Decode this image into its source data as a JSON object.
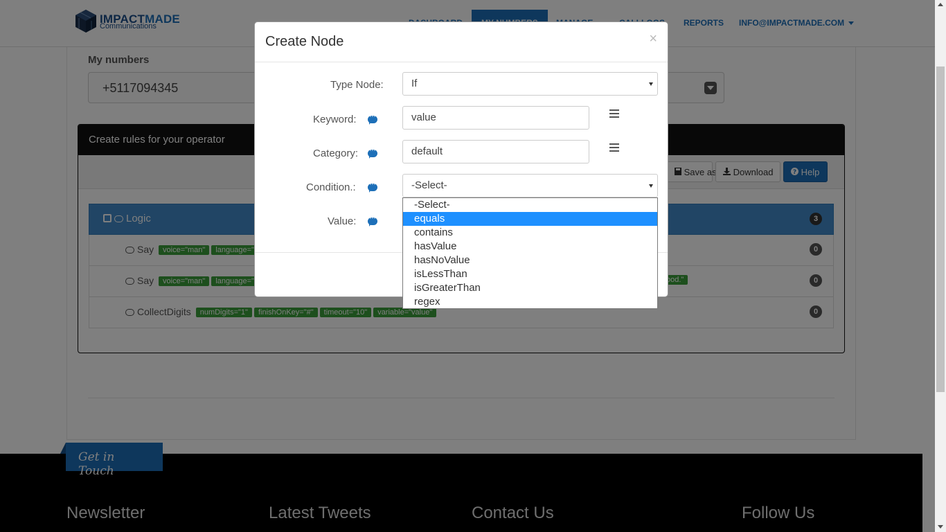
{
  "brand": {
    "name_part1": "IMPACT",
    "name_part2": "MADE",
    "tagline": "Communications"
  },
  "nav": {
    "items": [
      {
        "label": "DASHBOARD"
      },
      {
        "label": "MY NUMBERS"
      },
      {
        "label": "MANAGE"
      },
      {
        "label": "CALLLOGS"
      },
      {
        "label": "REPORTS"
      },
      {
        "label": "INFO@IMPACTMADE.COM"
      }
    ]
  },
  "numbers": {
    "label": "My numbers",
    "selected": "+5117094345"
  },
  "rules": {
    "title": "Create rules for your operator",
    "toolbar": {
      "save_as": "Save as",
      "download": "Download",
      "help": "Help"
    },
    "root": {
      "label": "Logic",
      "count": "3"
    },
    "rows": [
      {
        "label": "Say",
        "attrs": [
          "voice=\"man\"",
          "language=\"e"
        ],
        "trail": "ood.\"",
        "count": "0"
      },
      {
        "label": "Say",
        "attrs": [
          "voice=\"man\"",
          "language=\"e"
        ],
        "trail": "",
        "count": "0"
      },
      {
        "label": "CollectDigits",
        "attrs": [
          "numDigits=\"1\"",
          "finishOnKey=\"#\"",
          "timeout=\"10\"",
          "variable=\"value\""
        ],
        "trail": "",
        "count": "0"
      }
    ]
  },
  "footer": {
    "tab": "Get in Touch",
    "columns": [
      "Newsletter",
      "Latest Tweets",
      "Contact Us",
      "Follow Us"
    ]
  },
  "modal": {
    "title": "Create Node",
    "close": "×",
    "type_node": {
      "label": "Type Node:",
      "value": "If"
    },
    "keyword": {
      "label": "Keyword:",
      "value": "value"
    },
    "category": {
      "label": "Category:",
      "value": "default"
    },
    "condition": {
      "label": "Condition.:",
      "value": "-Select-"
    },
    "value_field": {
      "label": "Value:"
    },
    "condition_options": [
      "-Select-",
      "equals",
      "contains",
      "hasValue",
      "hasNoValue",
      "isLessThan",
      "isGreaterThan",
      "regex"
    ],
    "highlighted_option": "equals"
  },
  "colors": {
    "brand_blue": "#1d6fb8",
    "highlight": "#1e90ff",
    "attr_green": "#3a9e3a"
  }
}
